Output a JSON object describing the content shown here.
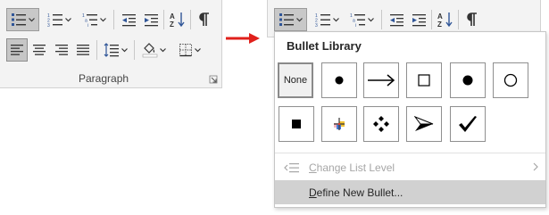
{
  "ribbon": {
    "group_label": "Paragraph"
  },
  "bullet_library": {
    "title": "Bullet Library",
    "none_label": "None",
    "bullets": [
      {
        "name": "none",
        "glyph": ""
      },
      {
        "name": "filled-circle",
        "glyph": "●"
      },
      {
        "name": "arrow-right",
        "glyph": "→"
      },
      {
        "name": "hollow-square",
        "glyph": "□"
      },
      {
        "name": "filled-circle-bold",
        "glyph": "●"
      },
      {
        "name": "hollow-circle",
        "glyph": "○"
      },
      {
        "name": "filled-square",
        "glyph": "■"
      },
      {
        "name": "color-cross",
        "glyph": ""
      },
      {
        "name": "four-diamonds",
        "glyph": "❖"
      },
      {
        "name": "arrowhead",
        "glyph": "➢"
      },
      {
        "name": "checkmark",
        "glyph": "✓"
      }
    ]
  },
  "menu": {
    "change_list_level": {
      "prefix": "",
      "accel": "C",
      "rest": "hange List Level"
    },
    "define_new_bullet": {
      "prefix": "",
      "accel": "D",
      "rest": "efine New Bullet..."
    }
  },
  "colors": {
    "arrow": "#e0201b",
    "selected_bg": "#c8c8c8",
    "hover_bg": "#d1d1d1"
  }
}
